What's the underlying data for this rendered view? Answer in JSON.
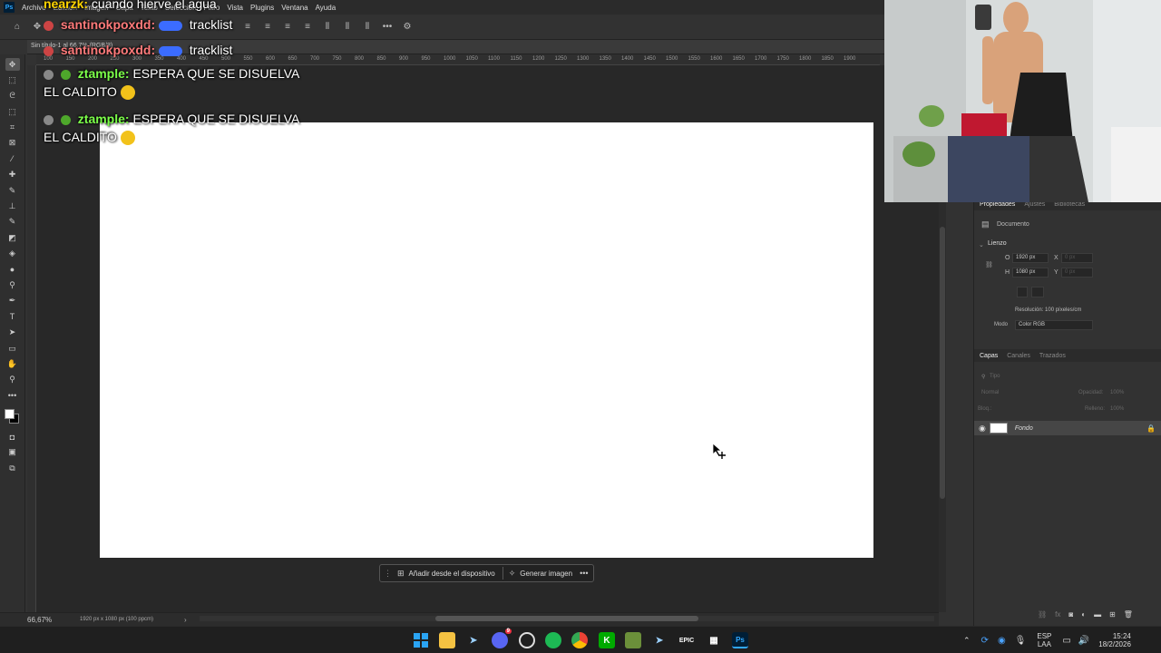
{
  "menubar": {
    "items": [
      "Archivo",
      "Edición",
      "Imagen",
      "Capa",
      "Texto",
      "Selección",
      "Filtro",
      "Vista",
      "Plugins",
      "Ventana",
      "Ayuda"
    ]
  },
  "doc_tab": {
    "label": "Sin título-1 al 66,7% (RGB/8)"
  },
  "ruler": {
    "ticks": [
      "100",
      "150",
      "200",
      "250",
      "300",
      "350",
      "400",
      "450",
      "500",
      "550",
      "600",
      "650",
      "700",
      "750",
      "800",
      "850",
      "900",
      "950",
      "1000",
      "1050",
      "1100",
      "1150",
      "1200",
      "1250",
      "1300",
      "1350",
      "1400",
      "1450",
      "1500",
      "1550",
      "1600",
      "1650",
      "1700",
      "1750",
      "1800",
      "1850",
      "1900"
    ]
  },
  "context_bar": {
    "add_from_device": "Añadir desde el dispositivo",
    "generate_image": "Generar imagen"
  },
  "statusbar": {
    "zoom": "66,67%",
    "doc_info": "1920 px x 1080 px (100 ppcm)"
  },
  "properties_panel": {
    "tabs": [
      "Propiedades",
      "Ajustes",
      "Bibliotecas"
    ],
    "section_document": "Documento",
    "section_canvas": "Lienzo",
    "width_label": "O",
    "width_value": "1920 px",
    "height_label": "H",
    "height_value": "1080 px",
    "x_label": "X",
    "y_label": "Y",
    "x_placeholder": "0 px",
    "y_placeholder": "0 px",
    "resolution": "Resolución: 100 píxeles/cm",
    "mode_label": "Modo",
    "mode_value": "Color RGB"
  },
  "layers_panel": {
    "tabs": [
      "Capas",
      "Canales",
      "Trazados"
    ],
    "search_placeholder": "Tipo",
    "blend_mode": "Normal",
    "opacity_label": "Opacidad:",
    "opacity_value": "100%",
    "lock_label": "Bloq.:",
    "fill_label": "Relleno:",
    "fill_value": "100%",
    "layers": [
      {
        "name": "Fondo",
        "visible": true,
        "locked": true
      }
    ]
  },
  "chat_overlay": {
    "messages": [
      {
        "user": "nearzk:",
        "text": "cuando hierve el agua",
        "user_color": "#ffd400"
      },
      {
        "user": "santinokpoxdd:",
        "text": "tracklist",
        "user_color": "#ff7a7a"
      },
      {
        "user": "santinokpoxdd:",
        "text": "tracklist",
        "user_color": "#ff7a7a"
      },
      {
        "user": "ztample:",
        "text": "ESPERA QUE SE DISUELVA EL CALDITO",
        "user_color": "#7cff4a"
      },
      {
        "user": "ztample:",
        "text": "ESPERA QUE SE DISUELVA EL CALDITO",
        "user_color": "#7cff4a"
      }
    ]
  },
  "taskbar": {
    "language": "ESP",
    "layout": "LAA",
    "time": "15:24",
    "date": "18/2/2026",
    "discord_badge": "9"
  },
  "colors": {
    "accent": "#31a8ff",
    "canvas": "#ffffff",
    "workspace": "#282828"
  }
}
